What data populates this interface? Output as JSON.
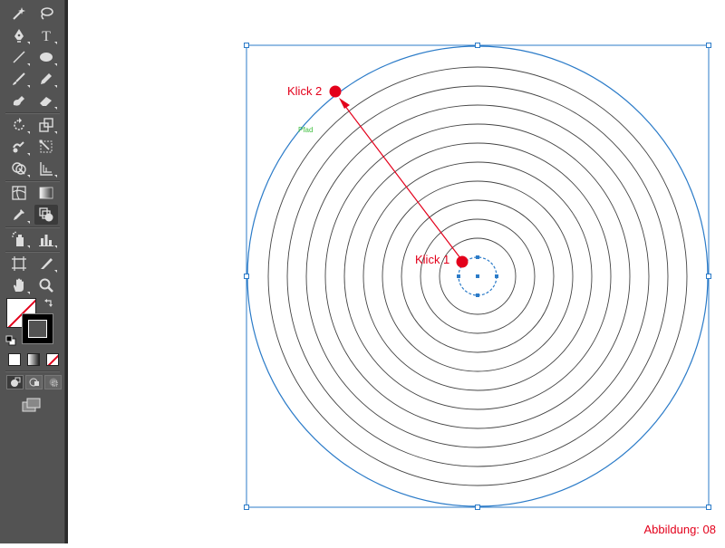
{
  "tools": [
    {
      "name": "magic-wand-tool",
      "icon": "magic-wand-icon"
    },
    {
      "name": "lasso-tool",
      "icon": "lasso-icon"
    },
    {
      "name": "pen-tool",
      "icon": "pen-icon"
    },
    {
      "name": "type-tool",
      "icon": "type-icon",
      "glyph": "T"
    },
    {
      "name": "line-tool",
      "icon": "line-icon"
    },
    {
      "name": "ellipse-tool",
      "icon": "ellipse-icon"
    },
    {
      "name": "brush-tool",
      "icon": "brush-icon"
    },
    {
      "name": "pencil-tool",
      "icon": "pencil-icon"
    },
    {
      "name": "blob-brush-tool",
      "icon": "blob-brush-icon"
    },
    {
      "name": "eraser-tool",
      "icon": "eraser-icon"
    },
    {
      "name": "rotate-tool",
      "icon": "rotate-icon"
    },
    {
      "name": "scale-tool",
      "icon": "scale-icon"
    },
    {
      "name": "warp-tool",
      "icon": "warp-icon"
    },
    {
      "name": "free-transform-tool",
      "icon": "free-transform-icon"
    },
    {
      "name": "shape-builder-tool",
      "icon": "shape-builder-icon"
    },
    {
      "name": "perspective-grid-tool",
      "icon": "perspective-grid-icon"
    },
    {
      "name": "mesh-tool",
      "icon": "mesh-icon"
    },
    {
      "name": "gradient-tool",
      "icon": "gradient-icon"
    },
    {
      "name": "eyedropper-tool",
      "icon": "eyedropper-icon"
    },
    {
      "name": "blend-tool",
      "icon": "blend-icon"
    },
    {
      "name": "symbol-sprayer-tool",
      "icon": "symbol-sprayer-icon"
    },
    {
      "name": "column-graph-tool",
      "icon": "column-graph-icon"
    },
    {
      "name": "artboard-tool",
      "icon": "artboard-icon"
    },
    {
      "name": "slice-tool",
      "icon": "slice-icon"
    },
    {
      "name": "hand-tool",
      "icon": "hand-icon"
    },
    {
      "name": "zoom-tool",
      "icon": "zoom-icon"
    }
  ],
  "colors": {
    "accent_red": "#e3001b",
    "selection_blue": "#2b7bc8",
    "path_label_green": "#3fbf3f",
    "toolbar_bg": "#535353"
  },
  "canvas": {
    "klick1_label": "Klick 1",
    "klick2_label": "Klick 2",
    "path_label": "Pfad",
    "caption": "Abbildung: 08"
  }
}
